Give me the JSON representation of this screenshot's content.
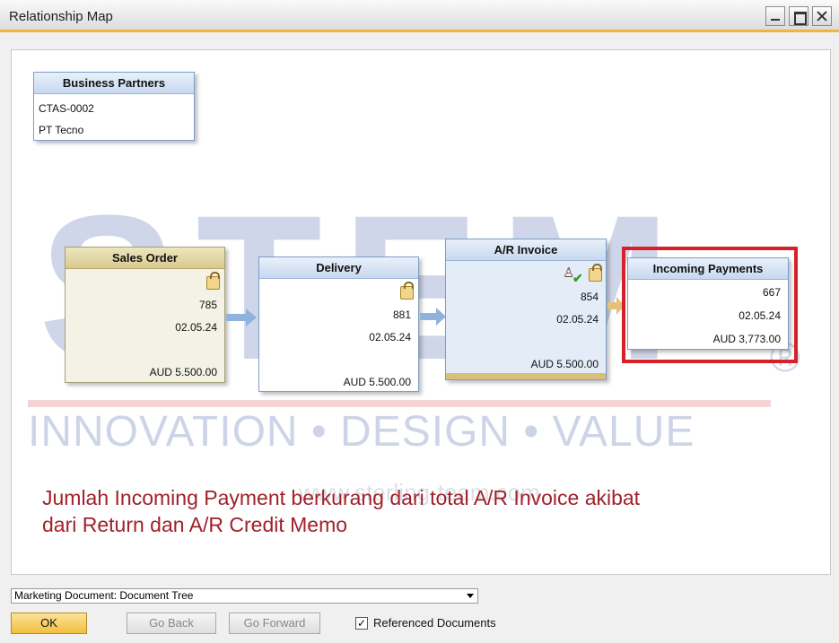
{
  "window": {
    "title": "Relationship Map"
  },
  "map": {
    "business_partners": {
      "header": "Business Partners",
      "code": "CTAS-0002",
      "name": "PT Tecno"
    },
    "sales_order": {
      "header": "Sales Order",
      "number": "785",
      "date": "02.05.24",
      "amount": "AUD 5.500.00"
    },
    "delivery": {
      "header": "Delivery",
      "number": "881",
      "date": "02.05.24",
      "amount": "AUD 5.500.00"
    },
    "ar_invoice": {
      "header": "A/R Invoice",
      "number": "854",
      "date": "02.05.24",
      "amount": "AUD 5.500.00"
    },
    "incoming_payments": {
      "header": "Incoming Payments",
      "number": "667",
      "date": "02.05.24",
      "amount": "AUD 3,773.00"
    }
  },
  "watermark": {
    "letters": "STEM",
    "registered": "®",
    "tagline": "INNOVATION • DESIGN • VALUE",
    "url": "www.sterling-team.com"
  },
  "note": {
    "line1": "Jumlah Incoming Payment berkurang dari total A/R Invoice akibat",
    "line2": "dari Return dan A/R Credit Memo"
  },
  "footer": {
    "view_select": "Marketing Document: Document Tree",
    "ok_label": "OK",
    "back_label": "Go Back",
    "forward_label": "Go Forward",
    "referenced_label": "Referenced Documents",
    "referenced_checked": true
  },
  "colors": {
    "accent": "#f2b43c",
    "highlight": "#d8202a",
    "note": "#a0212a"
  }
}
